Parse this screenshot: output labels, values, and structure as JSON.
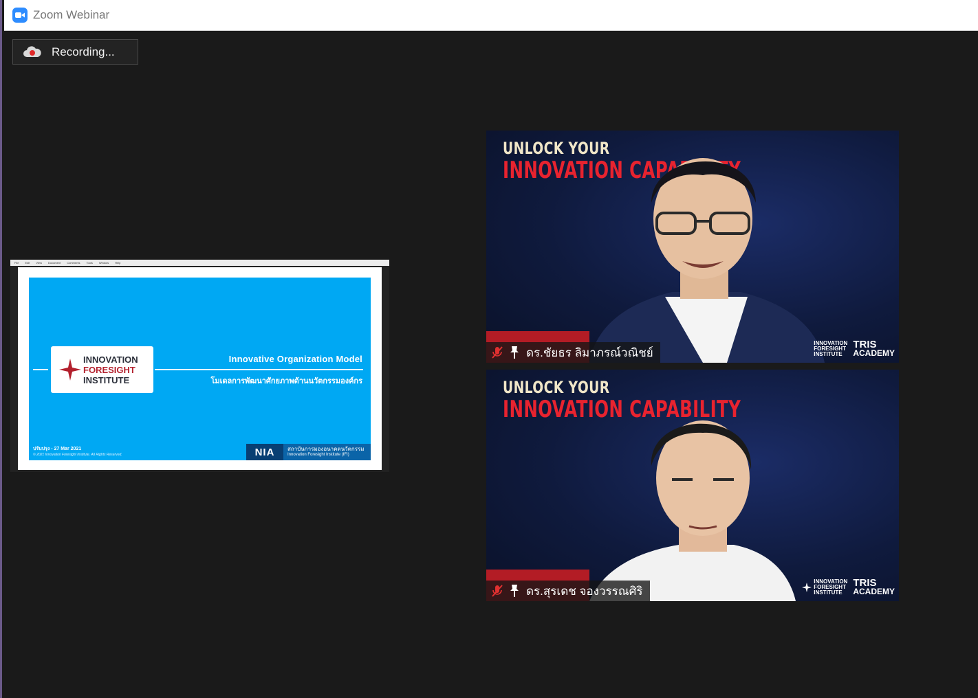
{
  "window": {
    "title": "Zoom Webinar",
    "border_color": "#6b5a8a"
  },
  "recording": {
    "label": "Recording...",
    "icon": "cloud-record-icon"
  },
  "shared_screen": {
    "menu": [
      "File",
      "Edit",
      "View",
      "Document",
      "Comments",
      "Tools",
      "Window",
      "Help"
    ],
    "slide": {
      "logo_line1": "INNOVATION",
      "logo_line2": "FORESIGHT",
      "logo_line3": "INSTITUTE",
      "title": "Innovative Organization Model",
      "subtitle": "โมเดลการพัฒนาศักยภาพด้านนวัตกรรมองค์กร",
      "date": "ปรับปรุง - 27 Mar 2021",
      "copyright": "© 2021 Innovation Foresight Institute. All Rights Reserved.",
      "nia_logo": "NIA",
      "nia_line1": "สถาบันการมองอนาคตนวัตกรรม",
      "nia_line2": "Innovation Foresight Institute (IFI)",
      "background": "#00a8f3"
    }
  },
  "videos": [
    {
      "banner_line1": "UNLOCK YOUR",
      "banner_line2": "INNOVATION CAPABILITY",
      "name": "ดร.ชัยธร ลิมาภรณ์วณิชย์",
      "muted": true,
      "ifi_logo": [
        "INNOVATION",
        "FORESIGHT",
        "INSTITUTE"
      ],
      "tris_line1": "TRIS",
      "tris_line2": "ACADEMY"
    },
    {
      "banner_line1": "UNLOCK YOUR",
      "banner_line2": "INNOVATION CAPABILITY",
      "name": "ดร.สุรเดช จองวรรณศิริ",
      "muted": true,
      "ifi_logo": [
        "INNOVATION",
        "FORESIGHT",
        "INSTITUTE"
      ],
      "tris_line1": "TRIS",
      "tris_line2": "ACADEMY"
    }
  ]
}
